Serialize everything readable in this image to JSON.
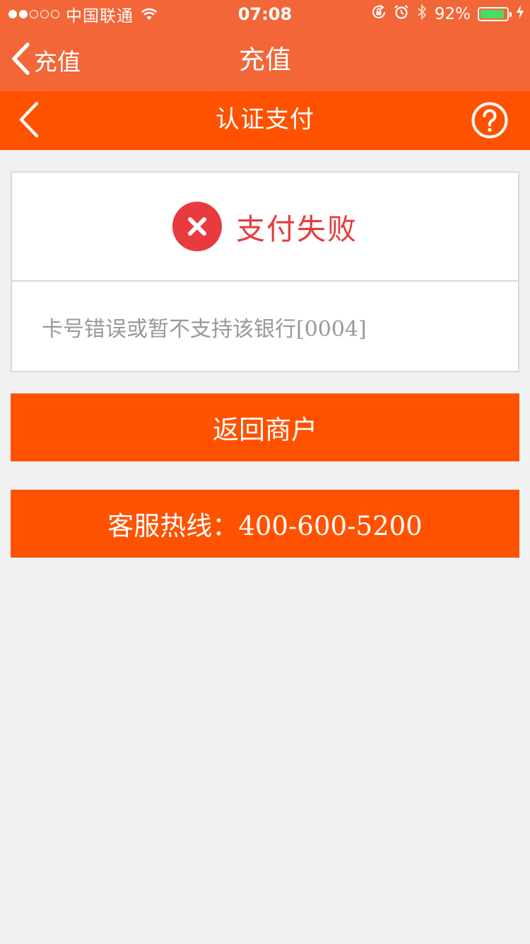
{
  "status_bar": {
    "carrier": "中国联通",
    "time": "07:08",
    "battery": "92%",
    "battery_level": 0.92,
    "signal_bars_filled": 2,
    "signal_bars_total": 5
  },
  "nav": {
    "back_label": "充值",
    "title": "充值"
  },
  "payment_header": {
    "title": "认证支付"
  },
  "result": {
    "title": "支付失败",
    "message": "卡号错误或暂不支持该银行[0004]"
  },
  "buttons": {
    "return_label": "返回商户",
    "hotline_label": "客服热线：400-600-5200"
  },
  "icons": {
    "back": "chevron-left-icon",
    "help": "question-circle-icon",
    "fail": "close-circle-icon"
  },
  "colors": {
    "nav_bar": "#f26638",
    "header": "#ff5200",
    "button": "#ff5200",
    "error": "#e83a3f",
    "background": "#f1f1f1"
  }
}
